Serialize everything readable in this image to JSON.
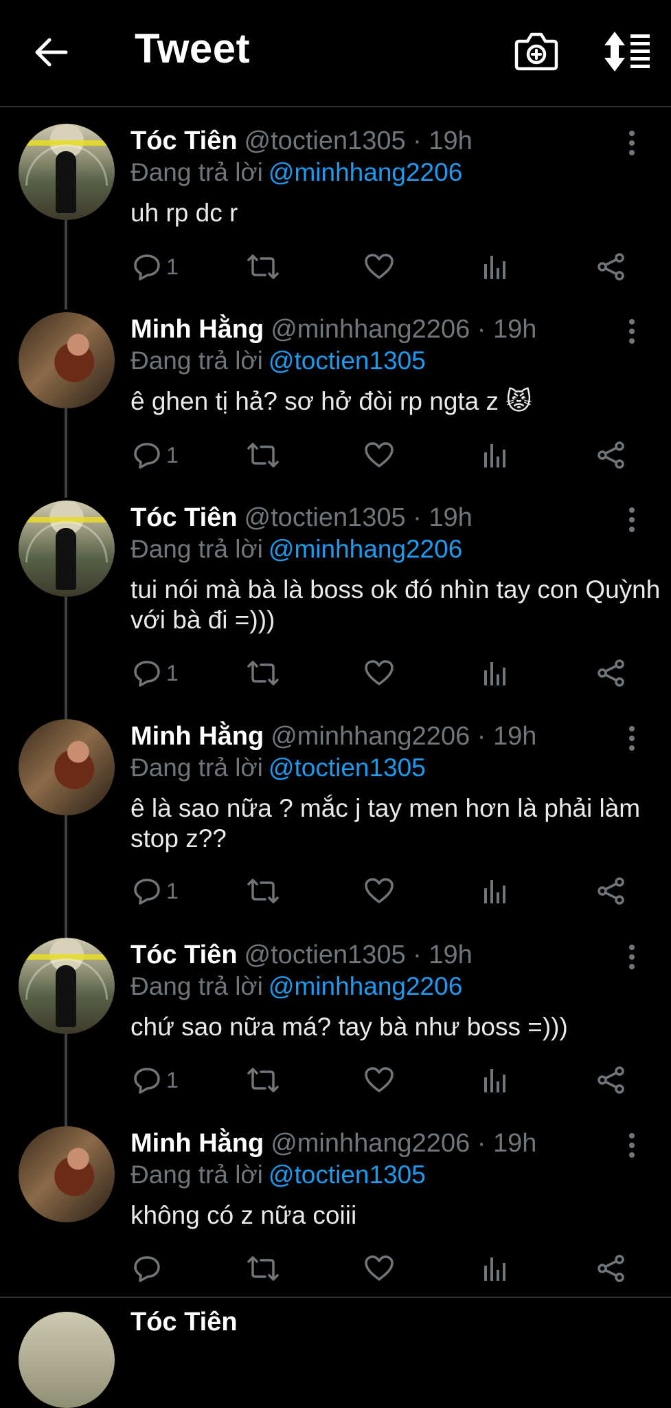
{
  "header": {
    "title": "Tweet",
    "back_icon": "arrow-left-icon",
    "camera_icon": "camera-plus-icon",
    "sort_icon": "sort-list-icon"
  },
  "colors": {
    "background": "#000000",
    "text": "#e7e9ea",
    "muted": "#71767b",
    "accent": "#1d9bf0"
  },
  "tweets": [
    {
      "name": "Tóc Tiên",
      "handle": "@toctien1305 · 19h",
      "reply_prefix": "Đang trả lời",
      "reply_to": "@minhhang2206",
      "text": "uh rp dc r",
      "replies": "1"
    },
    {
      "name": "Minh Hằng",
      "handle": "@minhhang2206 · 19h",
      "reply_prefix": "Đang trả lời",
      "reply_to": "@toctien1305",
      "text": "ê ghen tị hả? sơ hở đòi rp ngta z 😾",
      "replies": "1"
    },
    {
      "name": "Tóc Tiên",
      "handle": "@toctien1305 · 19h",
      "reply_prefix": "Đang trả lời",
      "reply_to": "@minhhang2206",
      "text": "tui nói mà bà là boss ok đó nhìn tay con Quỳnh với bà đi =)))",
      "replies": "1"
    },
    {
      "name": "Minh Hằng",
      "handle": "@minhhang2206 · 19h",
      "reply_prefix": "Đang trả lời",
      "reply_to": "@toctien1305",
      "text": "ê là sao nữa ? mắc j tay men hơn là phải làm stop z??",
      "replies": "1"
    },
    {
      "name": "Tóc Tiên",
      "handle": "@toctien1305 · 19h",
      "reply_prefix": "Đang trả lời",
      "reply_to": "@minhhang2206",
      "text": "chứ sao nữa má? tay bà như boss =)))",
      "replies": "1"
    },
    {
      "name": "Minh Hằng",
      "handle": "@minhhang2206 · 19h",
      "reply_prefix": "Đang trả lời",
      "reply_to": "@toctien1305",
      "text": "không có z nữa coiii",
      "replies": ""
    }
  ],
  "next_tweet": {
    "name": "Tóc Tiên"
  },
  "action_icons": [
    "reply-icon",
    "retweet-icon",
    "like-icon",
    "analytics-icon",
    "share-icon"
  ]
}
